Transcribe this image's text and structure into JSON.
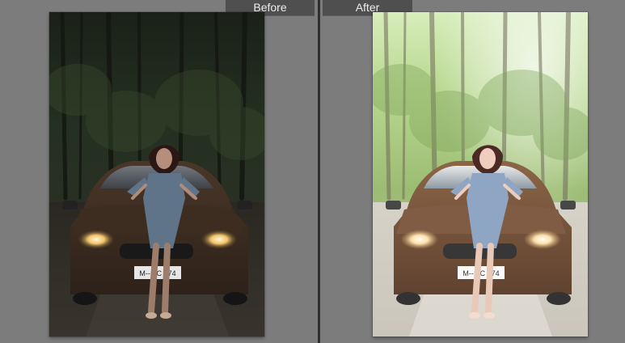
{
  "comparison": {
    "before_label": "Before",
    "after_label": "After"
  },
  "photos": {
    "before": {
      "subject": "woman-on-car-forest-road",
      "edit_state": "original-dark"
    },
    "after": {
      "subject": "woman-on-car-forest-road",
      "edit_state": "brightened"
    },
    "license_plate_text": "M-- TC 174"
  },
  "colors": {
    "app_background": "#7b7b7b",
    "label_background": "#4f4f4f",
    "label_text": "#ececec",
    "divider": "#2f2f2f",
    "car_body": "#6b4a33",
    "dress": "#8ea5c4"
  }
}
